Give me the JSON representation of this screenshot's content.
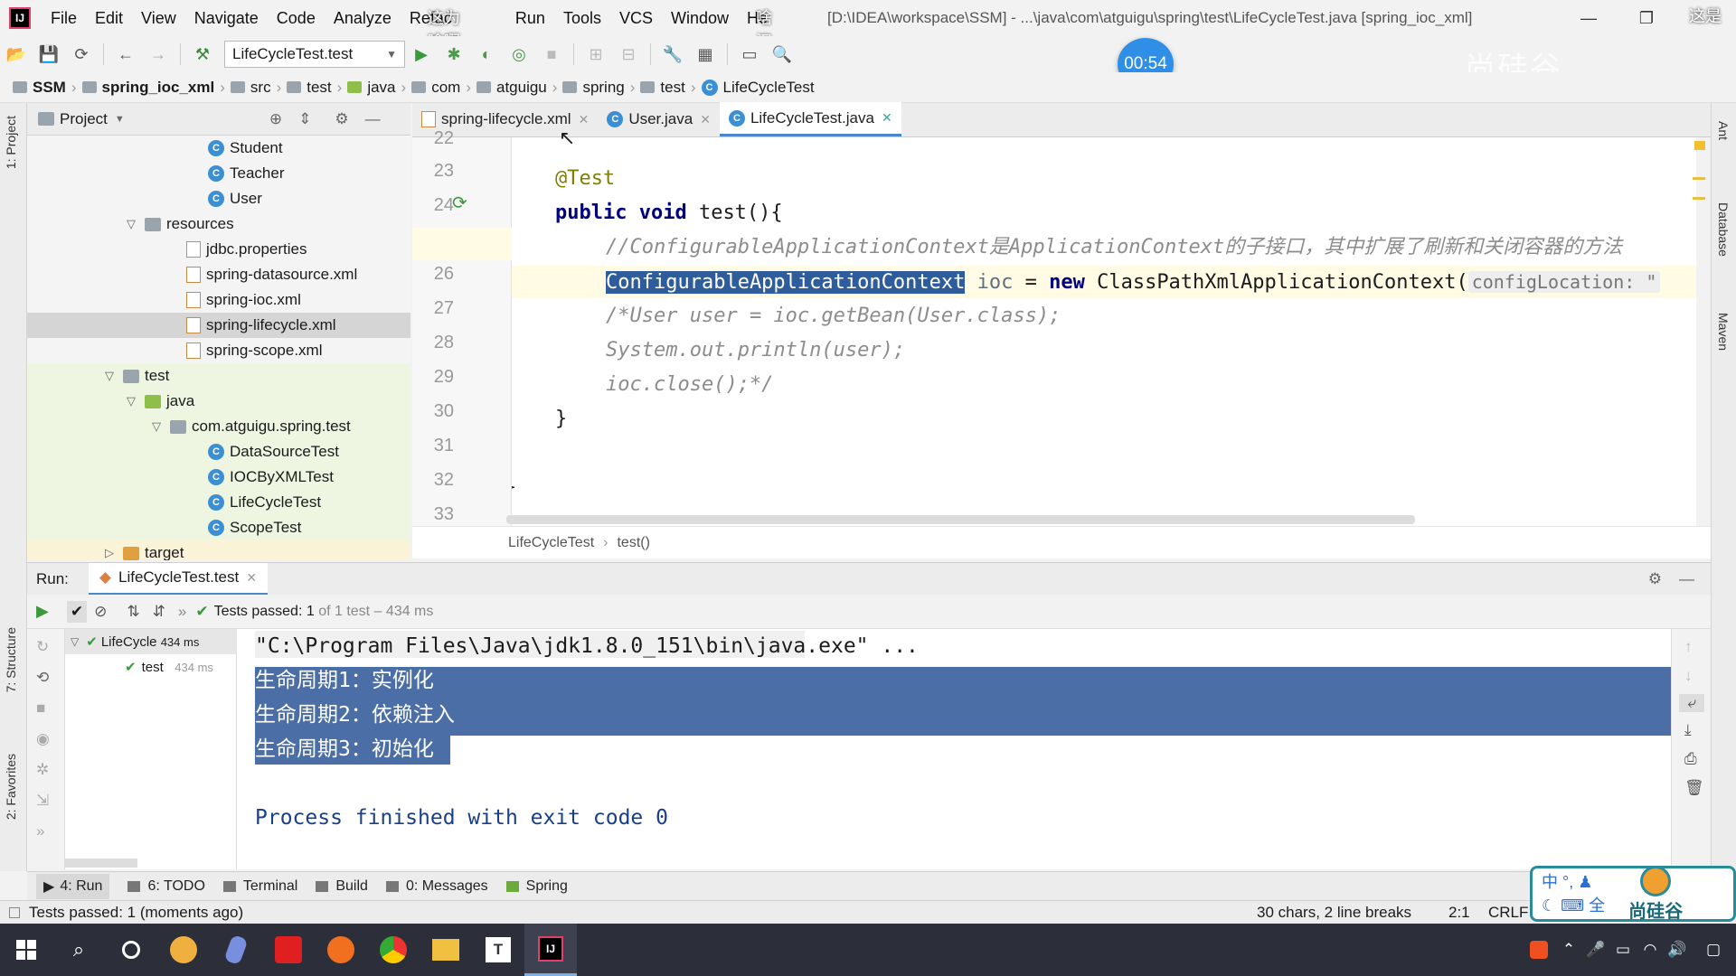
{
  "window": {
    "title": "[D:\\IDEA\\workspace\\SSM] - ...\\java\\com\\atguigu\\spring\\test\\LifeCycleTest.java [spring_ioc_xml]",
    "menu": [
      "File",
      "Edit",
      "View",
      "Navigate",
      "Code",
      "Analyze",
      "Refactor",
      "Build",
      "Run",
      "Tools",
      "VCS",
      "Window",
      "Help"
    ],
    "overlay_text_1": "这为啥啊",
    "overlay_text_2": "啥汉式?",
    "overlay_text_3": "这是"
  },
  "toolbar": {
    "run_config": "LifeCycleTest.test"
  },
  "timer": "00:54",
  "watermark": "尚硅谷",
  "breadcrumbs": [
    "SSM",
    "spring_ioc_xml",
    "src",
    "test",
    "java",
    "com",
    "atguigu",
    "spring",
    "test",
    "LifeCycleTest"
  ],
  "project": {
    "label": "Project",
    "nodes": [
      {
        "label": "Student",
        "kind": "class"
      },
      {
        "label": "Teacher",
        "kind": "class"
      },
      {
        "label": "User",
        "kind": "class"
      },
      {
        "label": "resources",
        "kind": "folder"
      },
      {
        "label": "jdbc.properties",
        "kind": "props"
      },
      {
        "label": "spring-datasource.xml",
        "kind": "xml"
      },
      {
        "label": "spring-ioc.xml",
        "kind": "xml"
      },
      {
        "label": "spring-lifecycle.xml",
        "kind": "xml"
      },
      {
        "label": "spring-scope.xml",
        "kind": "xml"
      },
      {
        "label": "test",
        "kind": "folder"
      },
      {
        "label": "java",
        "kind": "folder"
      },
      {
        "label": "com.atguigu.spring.test",
        "kind": "package"
      },
      {
        "label": "DataSourceTest",
        "kind": "class"
      },
      {
        "label": "IOCByXMLTest",
        "kind": "class"
      },
      {
        "label": "LifeCycleTest",
        "kind": "class"
      },
      {
        "label": "ScopeTest",
        "kind": "class"
      },
      {
        "label": "target",
        "kind": "folder"
      }
    ]
  },
  "editor": {
    "tabs": [
      {
        "label": "spring-lifecycle.xml",
        "active": false
      },
      {
        "label": "User.java",
        "active": false
      },
      {
        "label": "LifeCycleTest.java",
        "active": true
      }
    ],
    "line_numbers": [
      "22",
      "23",
      "24",
      "25",
      "26",
      "27",
      "28",
      "29",
      "30",
      "31",
      "32",
      "33"
    ],
    "code": {
      "l23": "@Test",
      "l24_kw": "public void",
      "l24_rest": " test(){",
      "l25": "//ConfigurableApplicationContext是ApplicationContext的子接口，其中扩展了刷新和关闭容器的方法",
      "l26_sel": "ConfigurableApplicationContext",
      "l26_var": " ioc",
      "l26_mid": " = ",
      "l26_new": "new",
      "l26_cls": " ClassPathXmlApplicationContext(",
      "l26_hint": "configLocation: \"",
      "l27": "/*User user = ioc.getBean(User.class);",
      "l28": "System.out.println(user);",
      "l29": "ioc.close();*/",
      "l30": "}",
      "l32": "}"
    },
    "breadcrumb": [
      "LifeCycleTest",
      "test()"
    ]
  },
  "run": {
    "label": "Run:",
    "tab": "LifeCycleTest.test",
    "status": "Tests passed:",
    "status_count": "1",
    "status_rest": "of 1 test – 434 ms",
    "tree": [
      {
        "label": "LifeCycle",
        "time": "434 ms"
      },
      {
        "label": "test",
        "time": "434 ms"
      }
    ],
    "console": [
      "\"C:\\Program Files\\Java\\jdk1.8.0_151\\bin\\java.exe\" ...",
      "生命周期1：实例化",
      "生命周期2：依赖注入",
      "生命周期3：初始化",
      "",
      "Process finished with exit code 0"
    ]
  },
  "tool_tabs": [
    "4: Run",
    "6: TODO",
    "Terminal",
    "Build",
    "0: Messages",
    "Spring"
  ],
  "side_tabs": {
    "left": [
      "1: Project",
      "7: Structure",
      "2: Favorites"
    ],
    "right": [
      "Ant",
      "Database",
      "Maven"
    ]
  },
  "statusbar": {
    "left": "Tests passed: 1 (moments ago)",
    "chars": "30 chars, 2 line breaks",
    "pos": "2:1",
    "eol": "CRLF"
  },
  "ime": {
    "line1": "中 °, ♟",
    "line2": "全",
    "brand": "尚硅谷"
  },
  "colors": {
    "accent": "#4a88c7",
    "selection": "#2f5c9a",
    "console_sel": "#4a6ea5",
    "taskbar": "#2c2f3a"
  }
}
